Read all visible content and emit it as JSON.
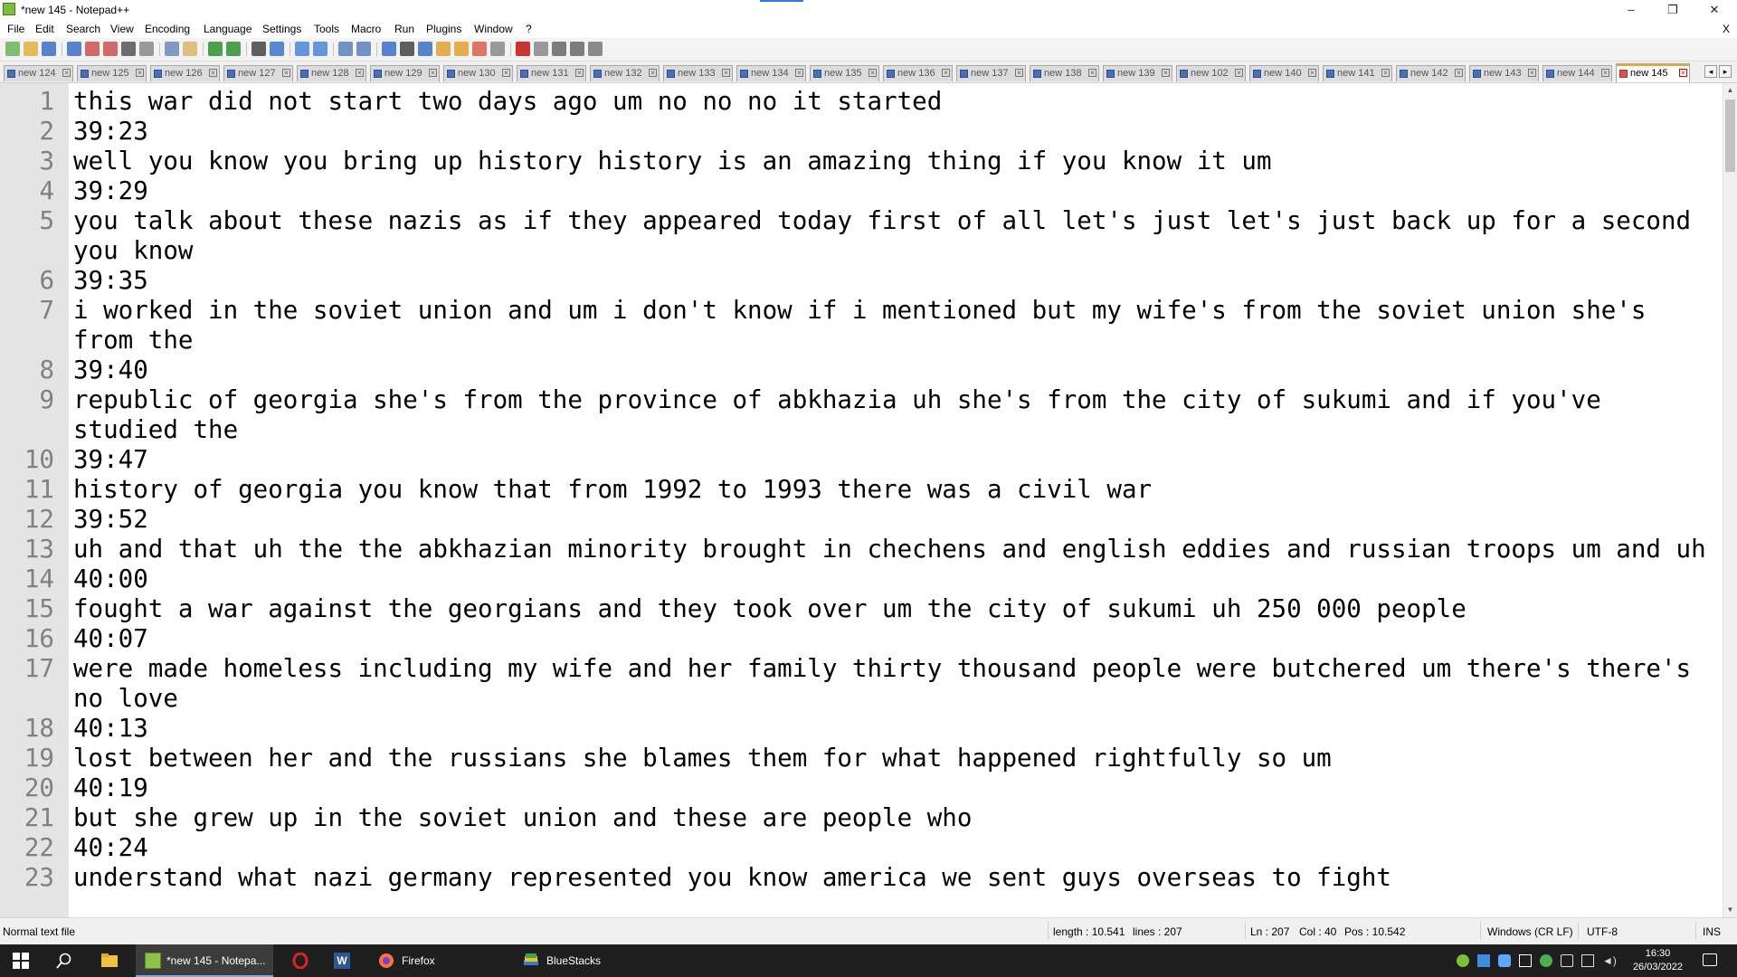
{
  "window": {
    "title": "*new 145 - Notepad++",
    "controls": {
      "minimize": "–",
      "maximize": "❐",
      "close": "✕"
    }
  },
  "menu": {
    "items": [
      "File",
      "Edit",
      "Search",
      "View",
      "Encoding",
      "Language",
      "Settings",
      "Tools",
      "Macro",
      "Run",
      "Plugins",
      "Window",
      "?"
    ],
    "close_doc": "X"
  },
  "toolbar": {
    "icons": [
      "new-file",
      "open-file",
      "save",
      "save-all",
      "close",
      "close-all",
      "print",
      "cut",
      "copy",
      "paste",
      "undo",
      "redo",
      "find",
      "replace",
      "zoom-in",
      "zoom-out",
      "sync-vertical",
      "sync-horizontal",
      "word-wrap",
      "show-all-chars",
      "indent-guide",
      "document-map",
      "function-list",
      "folder-as-workspace",
      "monitoring",
      "record-macro",
      "stop-macro",
      "play-macro",
      "run-macro-multiple",
      "save-macro"
    ]
  },
  "tabs": [
    {
      "label": "new 124",
      "active": false
    },
    {
      "label": "new 125",
      "active": false
    },
    {
      "label": "new 126",
      "active": false
    },
    {
      "label": "new 127",
      "active": false
    },
    {
      "label": "new 128",
      "active": false
    },
    {
      "label": "new 129",
      "active": false
    },
    {
      "label": "new 130",
      "active": false
    },
    {
      "label": "new 131",
      "active": false
    },
    {
      "label": "new 132",
      "active": false
    },
    {
      "label": "new 133",
      "active": false
    },
    {
      "label": "new 134",
      "active": false
    },
    {
      "label": "new 135",
      "active": false
    },
    {
      "label": "new 136",
      "active": false
    },
    {
      "label": "new 137",
      "active": false
    },
    {
      "label": "new 138",
      "active": false
    },
    {
      "label": "new 139",
      "active": false
    },
    {
      "label": "new 102",
      "active": false
    },
    {
      "label": "new 140",
      "active": false
    },
    {
      "label": "new 141",
      "active": false
    },
    {
      "label": "new 142",
      "active": false
    },
    {
      "label": "new 143",
      "active": false
    },
    {
      "label": "new 144",
      "active": false
    },
    {
      "label": "new 145",
      "active": true
    }
  ],
  "editor": {
    "lines": [
      {
        "n": "1",
        "text": "this war did not start two days ago um no no no it started"
      },
      {
        "n": "2",
        "text": "39:23"
      },
      {
        "n": "3",
        "text": "well you know you bring up history history is an amazing thing if you know it um"
      },
      {
        "n": "4",
        "text": "39:29"
      },
      {
        "n": "5",
        "text": "you talk about these nazis as if they appeared today first of all let's just let's just back up for a second you know"
      },
      {
        "n": "6",
        "text": "39:35"
      },
      {
        "n": "7",
        "text": "i worked in the soviet union and um i don't know if i mentioned but my wife's from the soviet union she's from the"
      },
      {
        "n": "8",
        "text": "39:40"
      },
      {
        "n": "9",
        "text": "republic of georgia she's from the province of abkhazia uh she's from the city of sukumi and if you've studied the"
      },
      {
        "n": "10",
        "text": "39:47"
      },
      {
        "n": "11",
        "text": "history of georgia you know that from 1992 to 1993 there was a civil war"
      },
      {
        "n": "12",
        "text": "39:52"
      },
      {
        "n": "13",
        "text": "uh and that uh the the abkhazian minority brought in chechens and english eddies and russian troops um and uh"
      },
      {
        "n": "14",
        "text": "40:00"
      },
      {
        "n": "15",
        "text": "fought a war against the georgians and they took over um the city of sukumi uh 250 000 people"
      },
      {
        "n": "16",
        "text": "40:07"
      },
      {
        "n": "17",
        "text": "were made homeless including my wife and her family thirty thousand people were butchered um there's there's no love"
      },
      {
        "n": "18",
        "text": "40:13"
      },
      {
        "n": "19",
        "text": "lost between her and the russians she blames them for what happened rightfully so um"
      },
      {
        "n": "20",
        "text": "40:19"
      },
      {
        "n": "21",
        "text": "but she grew up in the soviet union and these are people who"
      },
      {
        "n": "22",
        "text": "40:24"
      },
      {
        "n": "23",
        "text": "understand what nazi germany represented you know america we sent guys overseas to fight"
      }
    ]
  },
  "status": {
    "file_type": "Normal text file",
    "length": "length : 10.541",
    "lines": "lines : 207",
    "ln": "Ln : 207",
    "col": "Col : 40",
    "pos": "Pos : 10.542",
    "eol": "Windows (CR LF)",
    "encoding": "UTF-8",
    "mode": "INS"
  },
  "taskbar": {
    "apps": [
      {
        "name": "notepadpp",
        "label": "*new 145 - Notepa...",
        "active": true
      },
      {
        "name": "opera",
        "label": "",
        "active": false
      },
      {
        "name": "word",
        "label": "",
        "active": false
      },
      {
        "name": "firefox",
        "label": "Firefox",
        "active": false
      },
      {
        "name": "bluestacks",
        "label": "BlueStacks",
        "active": false
      }
    ],
    "time": "16:30",
    "date": "26/03/2022"
  },
  "colors": {
    "gutter": "#e4e4e4",
    "line_number": "#808080",
    "active_tab_accent": "#f5a623",
    "taskbar": "#1f1f1f"
  }
}
